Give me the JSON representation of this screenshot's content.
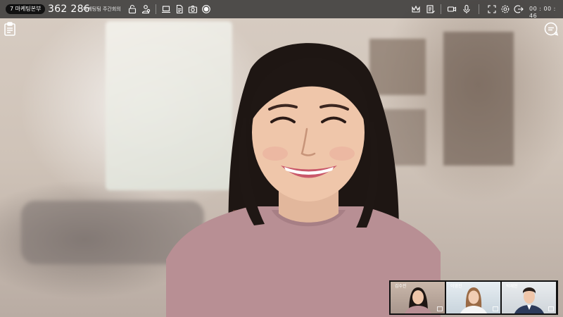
{
  "meeting": {
    "channel_badge": "7 마케팅본부",
    "room_number": "362 286",
    "room_name": "마케팅팀 주간회의",
    "elapsed_time": "00 : 00 : 46"
  },
  "toolbar_left_icons": [
    "lock-icon",
    "participants-icon",
    "screen-share-icon",
    "document-icon",
    "camera-snapshot-icon",
    "record-icon"
  ],
  "toolbar_right_icons": [
    "crown-icon",
    "notes-icon",
    "video-camera-icon",
    "microphone-icon",
    "fullscreen-icon",
    "settings-icon",
    "exit-icon"
  ],
  "side_buttons": {
    "left": "clipboard-icon",
    "right": "chat-icon"
  },
  "participants": [
    {
      "name": "김수진"
    },
    {
      "name": "이영진"
    },
    {
      "name": "박재현"
    }
  ]
}
